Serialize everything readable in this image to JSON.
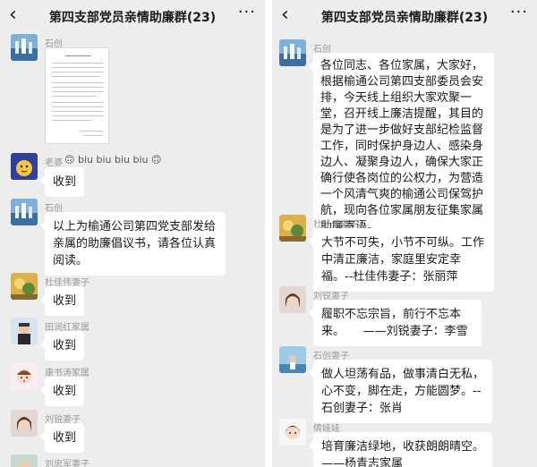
{
  "left": {
    "title": "第四支部党员亲情助廉群(23)",
    "back": "‹",
    "more": "···",
    "messages": [
      {
        "sender": "石创"
      },
      {
        "sender": "老婆",
        "reaction": "biu biu biu biu"
      },
      {
        "text": "收到"
      },
      {
        "sender": "石创",
        "text": "以上为榆通公司第四党支部发给亲属的助廉倡议书，请各位认真阅读。"
      },
      {
        "sender": "杜佳伟妻子",
        "text": "收到"
      },
      {
        "sender": "田润红家属",
        "text": "收到"
      },
      {
        "sender": "康书涛家属",
        "text": "收到"
      },
      {
        "sender": "刘锐妻子",
        "text": "收到"
      },
      {
        "sender": "刘忠军妻子"
      }
    ]
  },
  "right": {
    "title": "第四支部党员亲情助廉群(23)",
    "back": "‹",
    "more": "···",
    "messages": [
      {
        "sender": "石创",
        "text": "各位同志、各位家属，大家好，根据榆通公司第四支部委员会安排，今天线上组织大家欢聚一堂，召开线上廉洁提醒，其目的是为了进一步做好支部纪检监督工作，同时保护身边人、感染身边人、凝聚身边人，确保大家正确行使各岗位的公权力，为营造一个风清气爽的榆通公司保驾护航，现向各位家属朋友征集家属助廉寄语。"
      },
      {
        "sender": "杜佳伟妻子",
        "text": "大节不可失，小节不可纵。工作中清正廉洁，家庭里安定幸福。--杜佳伟妻子：张丽萍"
      },
      {
        "sender": "刘锐妻子",
        "text": "履职不忘宗旨，前行不忘本来。     ——刘锐妻子：李雪"
      },
      {
        "sender": "石创妻子",
        "text": "做人坦荡有品，做事清白无私，心不变，脚在走，方能圆梦。--石创妻子：张肖"
      },
      {
        "sender": "倩娃娃",
        "text": "培育廉洁绿地，收获朗朗晴空。——杨青志家属"
      }
    ]
  },
  "colors": {
    "chat_bg": "#ededed",
    "bubble": "#ffffff",
    "name": "#9a9a9a"
  }
}
